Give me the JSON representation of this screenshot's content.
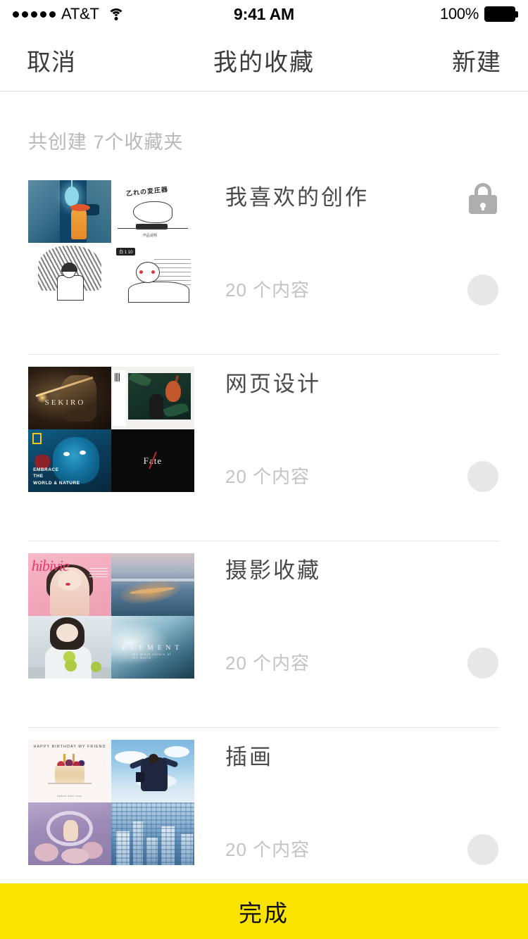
{
  "status_bar": {
    "carrier": "AT&T",
    "signal_dots": 5,
    "wifi_icon": "wifi-icon",
    "time": "9:41 AM",
    "battery_percent": "100%",
    "battery_icon": "battery-full-icon"
  },
  "nav_bar": {
    "cancel_label": "取消",
    "title": "我的收藏",
    "new_label": "新建"
  },
  "list_header": {
    "summary": "共创建 7个收藏夹"
  },
  "favorites": [
    {
      "name": "我喜欢的创作",
      "count_label": "20 个内容",
      "locked": true,
      "lock_icon": "lock-icon",
      "select_icon": "select-circle-icon",
      "thumbnails": [
        "dark-blue-cave-illustration",
        "japanese-sketch-cover",
        "throne-boy-sketch",
        "manga-sketch-notes"
      ]
    },
    {
      "name": "网页设计",
      "count_label": "20 个内容",
      "locked": false,
      "select_icon": "select-circle-icon",
      "thumbnails": [
        "sekiro-game-art",
        "guitar-jungle-magazine",
        "natgeo-blue-face",
        "fate-zero-poster"
      ]
    },
    {
      "name": "摄影收藏",
      "count_label": "20 个内容",
      "locked": false,
      "select_icon": "select-circle-icon",
      "thumbnails": [
        "pink-magazine-cover",
        "aerial-beach-photo",
        "girl-with-fruit-photo",
        "element-ocean-photo"
      ]
    },
    {
      "name": "插画",
      "count_label": "20 个内容",
      "locked": false,
      "select_icon": "select-circle-icon",
      "thumbnails": [
        "birthday-cake-illustration",
        "anime-sky-girl",
        "purple-fantasy-illustration",
        "blue-cityscape-illustration"
      ]
    }
  ],
  "artwork_text": {
    "sekiro_logo": "SEKIRO",
    "fate_logo": "Fate",
    "natgeo_caption": "EMBRACE<br>THE<br>WORLD & NATURE",
    "element_word": "ELEMENT",
    "element_sub": "the great nature of the world",
    "pink_script": "hibivie",
    "cake_header": "HAPPY BIRTHDAY MY FRIEND",
    "cake_footer": "baked with love",
    "sketch_title": "乙れの変圧器",
    "sketch_caption": "作品说明",
    "manga_tag": "白 1 10"
  },
  "footer": {
    "done_label": "完成",
    "done_bg": "#fbe300"
  },
  "colors": {
    "accent_yellow": "#fbe300",
    "text_primary": "#3c3c3c",
    "text_secondary": "#c3c3c3",
    "separator": "#e6e6e6",
    "circle": "#e7e7e7",
    "lock_gray": "#aeaeae"
  }
}
